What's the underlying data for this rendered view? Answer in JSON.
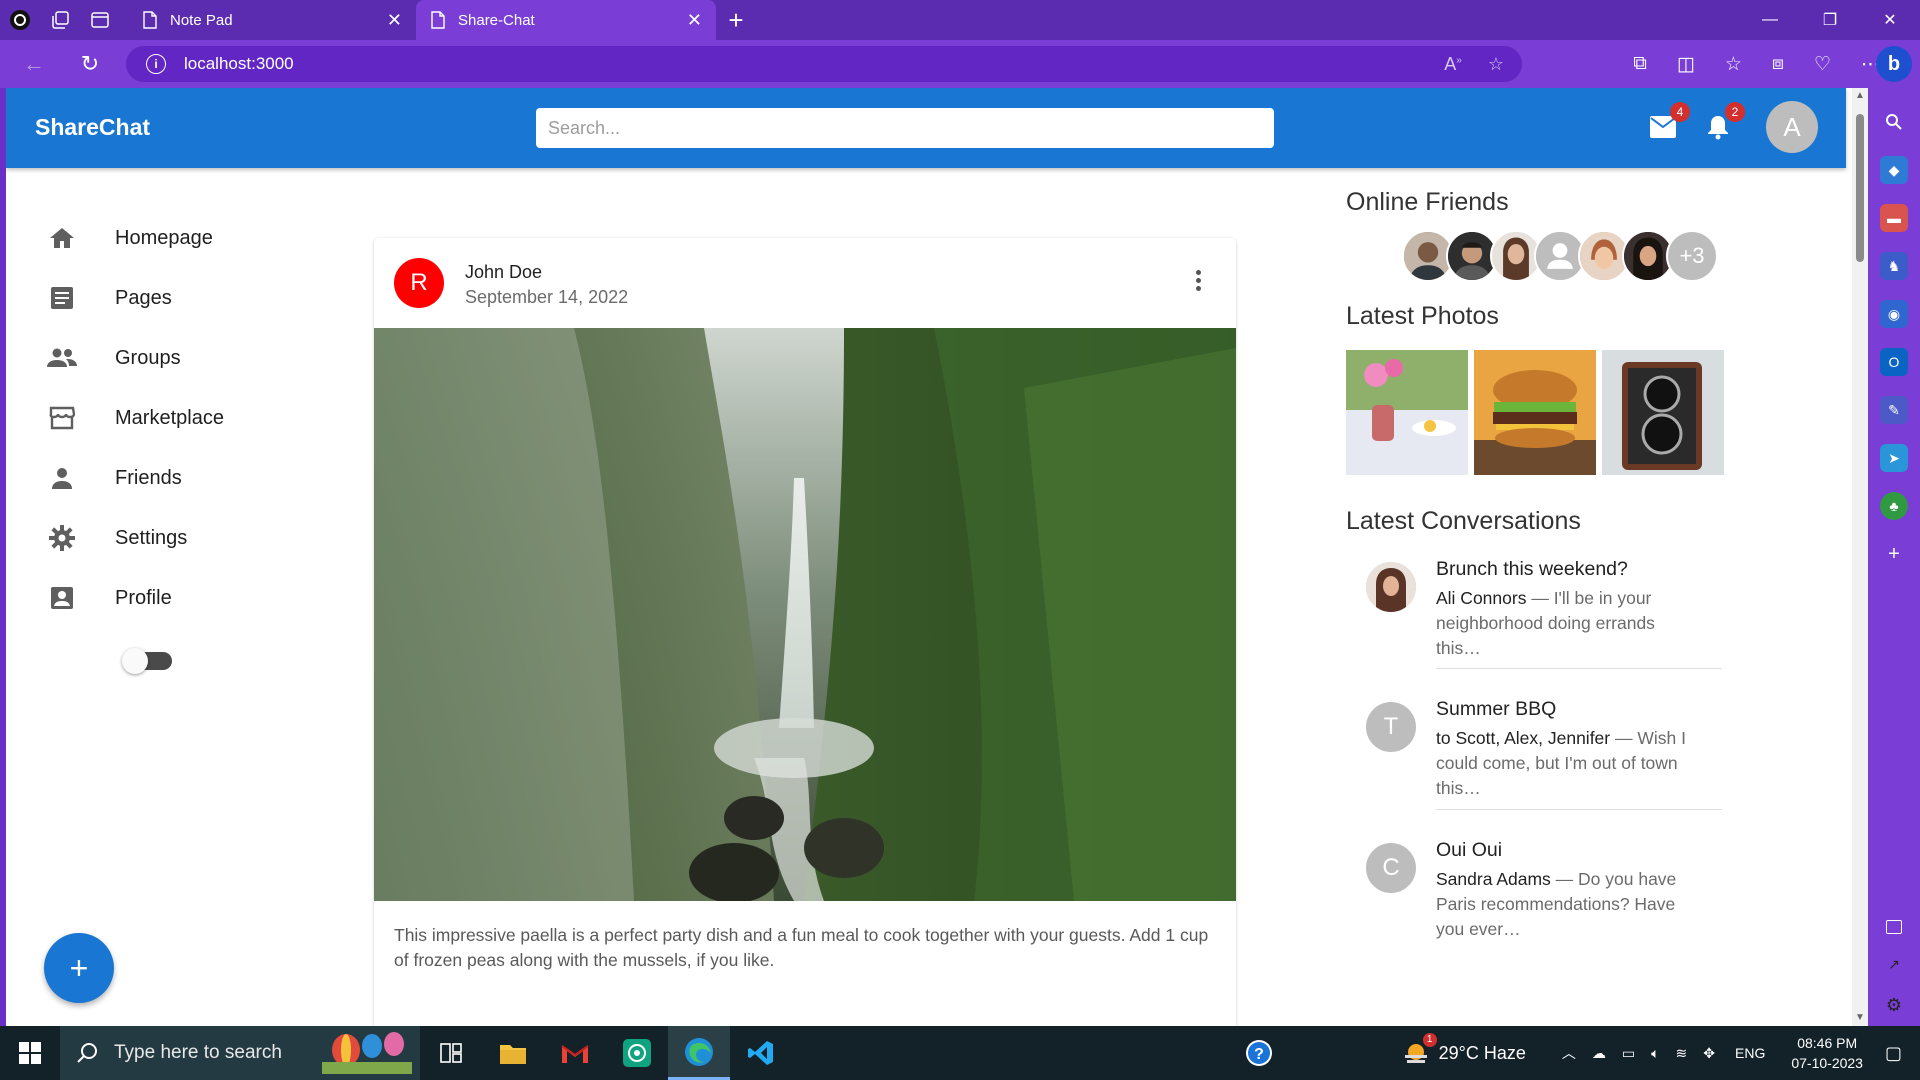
{
  "browser": {
    "tabs": [
      {
        "label": "Note Pad",
        "active": false
      },
      {
        "label": "Share-Chat",
        "active": true
      }
    ],
    "url": "localhost:3000"
  },
  "app": {
    "logo": "ShareChat",
    "search_placeholder": "Search...",
    "mail_badge": "4",
    "notif_badge": "2",
    "user_initial": "A"
  },
  "sidebar": {
    "items": [
      {
        "label": "Homepage",
        "icon": "home-icon"
      },
      {
        "label": "Pages",
        "icon": "article-icon"
      },
      {
        "label": "Groups",
        "icon": "group-icon"
      },
      {
        "label": "Marketplace",
        "icon": "storefront-icon"
      },
      {
        "label": "Friends",
        "icon": "person-icon"
      },
      {
        "label": "Settings",
        "icon": "settings-icon"
      },
      {
        "label": "Profile",
        "icon": "account-box-icon"
      }
    ],
    "dark_mode": false
  },
  "fab_label": "+",
  "post": {
    "avatar_initial": "R",
    "author": "John Doe",
    "date": "September 14, 2022",
    "text": "This impressive paella is a perfect party dish and a fun meal to cook together with your guests. Add 1 cup of frozen peas along with the mussels, if you like."
  },
  "rightbar": {
    "online_title": "Online Friends",
    "online_more": "+3",
    "photos_title": "Latest Photos",
    "conversations_title": "Latest Conversations",
    "conversations": [
      {
        "avatar": "",
        "title": "Brunch this weekend?",
        "who": "Ali Connors",
        "text": " — I'll be in your neighborhood doing errands this…"
      },
      {
        "avatar": "T",
        "title": "Summer BBQ",
        "who": "to Scott, Alex, Jennifer",
        "text": " — Wish I could come, but I'm out of town this…"
      },
      {
        "avatar": "C",
        "title": "Oui Oui",
        "who": "Sandra Adams",
        "text": " — Do you have Paris recommendations? Have you ever…"
      }
    ]
  },
  "taskbar": {
    "search_placeholder": "Type here to search",
    "weather": "29°C  Haze",
    "weather_alert": "1",
    "lang": "ENG",
    "time": "08:46 PM",
    "date": "07-10-2023"
  },
  "colors": {
    "primary": "#1976d2",
    "browser_purple": "#7a3ed6",
    "post_avatar": "#ff0000"
  }
}
